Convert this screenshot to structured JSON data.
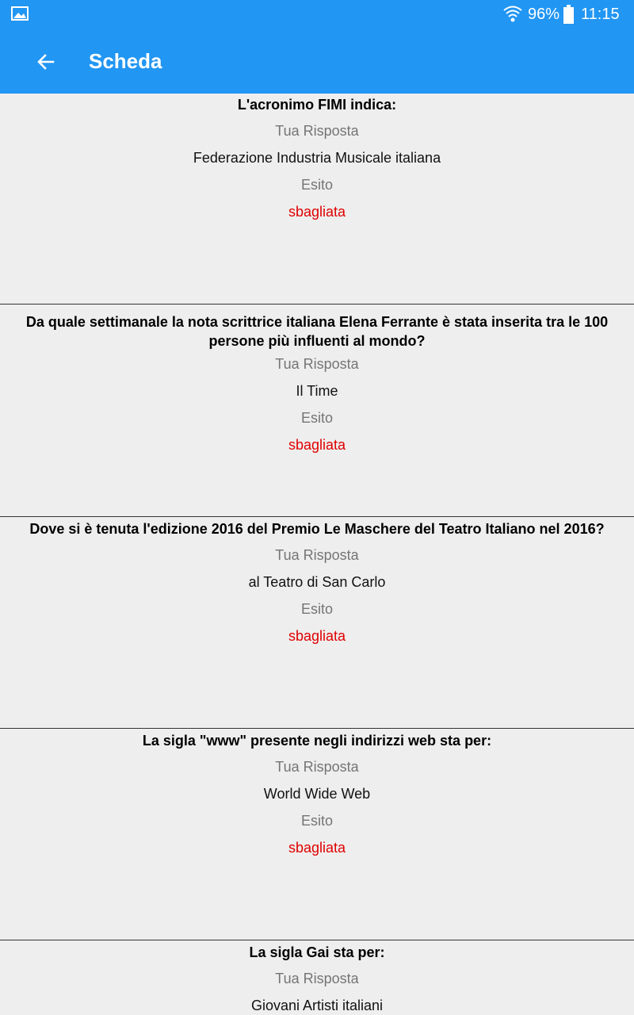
{
  "status_bar": {
    "battery_percent": "96%",
    "time": "11:15",
    "icons": [
      "gallery-icon",
      "wifi-icon",
      "battery-icon"
    ]
  },
  "app_bar": {
    "title": "Scheda",
    "back_icon": "arrow-left-icon",
    "color": "#2196f3"
  },
  "labels": {
    "answer_label": "Tua Risposta",
    "result_label": "Esito"
  },
  "colors": {
    "result_wrong": "#e00000",
    "label_gray": "#757575",
    "background": "#eeeeee"
  },
  "items": [
    {
      "question": "L'acronimo FIMI indica:",
      "answer": "Federazione Industria Musicale italiana",
      "result": "sbagliata"
    },
    {
      "question": "Da quale settimanale la nota scrittrice italiana Elena Ferrante è stata inserita tra le 100 persone più influenti al mondo?",
      "answer": "Il Time",
      "result": "sbagliata"
    },
    {
      "question": "Dove si è tenuta l'edizione 2016 del Premio Le Maschere del Teatro Italiano nel 2016?",
      "answer": "al Teatro di San Carlo",
      "result": "sbagliata"
    },
    {
      "question": "La sigla \"www\" presente negli indirizzi web sta per:",
      "answer": "World Wide Web",
      "result": "sbagliata"
    },
    {
      "question": "La sigla Gai sta per:",
      "answer": "Giovani Artisti italiani"
    }
  ]
}
